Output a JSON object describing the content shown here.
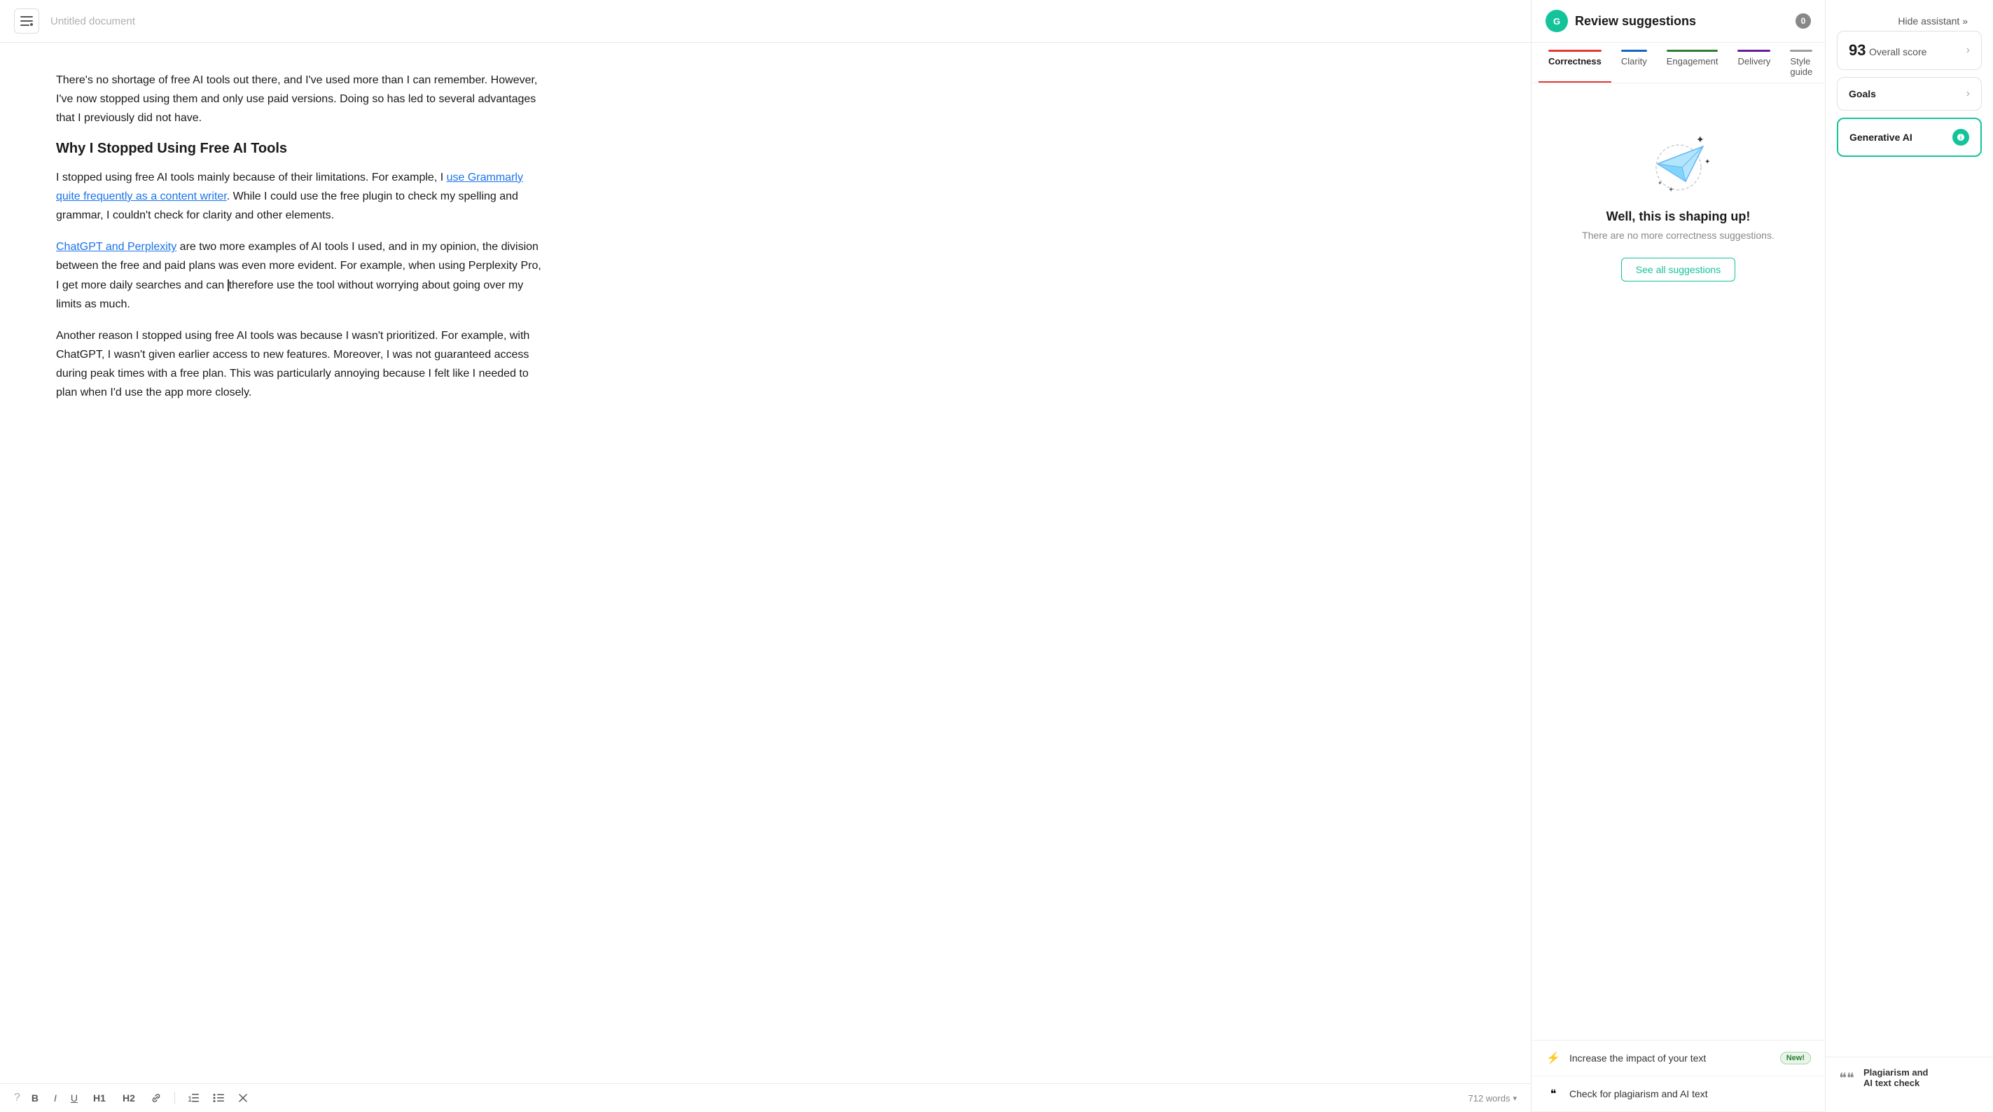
{
  "header": {
    "menu_icon": "☰·",
    "doc_title": "Untitled document"
  },
  "editor": {
    "paragraphs": [
      "There's no shortage of free AI tools out there, and I've used more than I can remember. However, I've now stopped using them and only use paid versions. Doing so has led to several advantages that I previously did not have.",
      "Why I Stopped Using Free AI Tools",
      "I stopped using free AI tools mainly because of their limitations. For example, I ",
      " use Grammarly quite frequently as a content writer",
      ". While I could use the free plugin to check my spelling and grammar, I couldn't check for clarity and other elements.",
      " are two more examples of AI tools I used, and in my opinion, the division between the free and paid plans was even more evident. For example, when using Perplexity Pro, I get more daily searches and can therefore use the tool without worrying about going over my limits as much.",
      "Another reason I stopped using free AI tools was because I wasn't prioritized. For example, with ChatGPT, I wasn't given earlier access to new features. Moreover, I was not guaranteed access during peak times with a free plan. This was particularly annoying because I felt like I needed to plan when I'd use the app more closely."
    ],
    "link1_text": "use Grammarly quite frequently as a content writer",
    "link2_text": "ChatGPT and Perplexity",
    "word_count": "712 words"
  },
  "toolbar": {
    "bold": "B",
    "italic": "I",
    "underline": "U",
    "h1": "H1",
    "h2": "H2",
    "link": "🔗",
    "ol": "ol",
    "ul": "ul",
    "clear": "✕"
  },
  "grammarly_panel": {
    "logo_letter": "G",
    "title": "Review suggestions",
    "count": "0",
    "tabs": [
      {
        "id": "correctness",
        "label": "Correctness",
        "color": "#e53935",
        "active": true
      },
      {
        "id": "clarity",
        "label": "Clarity",
        "color": "#1565c0"
      },
      {
        "id": "engagement",
        "label": "Engagement",
        "color": "#2e7d32"
      },
      {
        "id": "delivery",
        "label": "Delivery",
        "color": "#6a1b9a"
      },
      {
        "id": "style-guide",
        "label": "Style guide",
        "color": "#9e9e9e"
      }
    ],
    "success_title": "Well, this is shaping up!",
    "success_subtitle": "There are no more correctness suggestions.",
    "see_all_btn": "See all suggestions",
    "suggestions": [
      {
        "icon": "⚡",
        "text": "Increase the impact of your text",
        "badge": "New!"
      },
      {
        "icon": "❞",
        "text": "Check for plagiarism and AI text"
      }
    ]
  },
  "scores_panel": {
    "hide_btn": "Hide assistant »",
    "overall_score": "93",
    "overall_label": "Overall score",
    "goals_label": "Goals",
    "gen_ai_label": "Generative AI"
  }
}
